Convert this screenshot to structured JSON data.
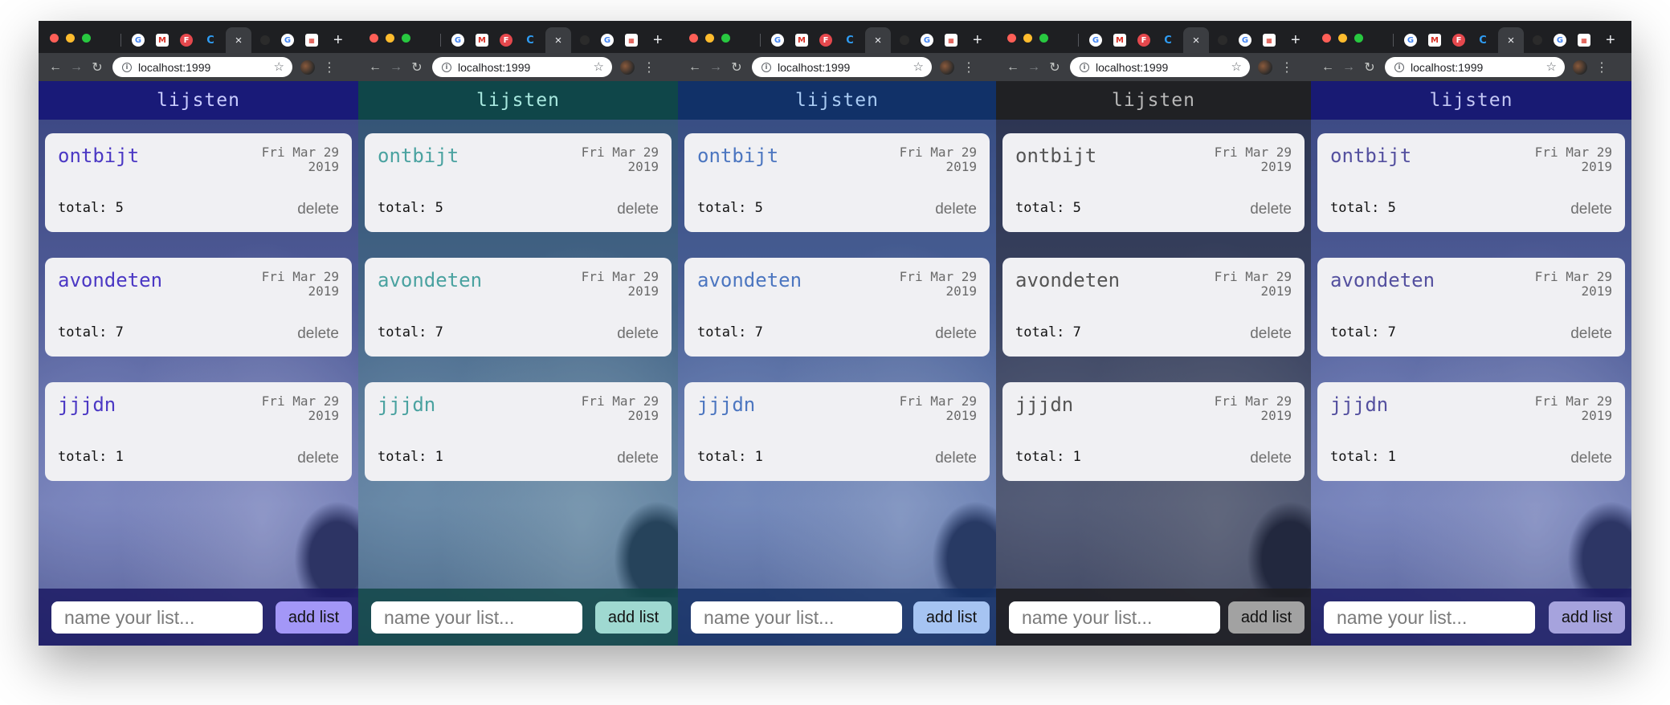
{
  "browser": {
    "url": "localhost:1999",
    "tab_close_glyph": "×",
    "new_tab_glyph": "+"
  },
  "app": {
    "title": "lijsten",
    "lists": [
      {
        "name": "ontbijt",
        "date_line1": "Fri Mar 29",
        "date_line2": "2019",
        "total_label": "total: 5",
        "delete_label": "delete"
      },
      {
        "name": "avondeten",
        "date_line1": "Fri Mar 29",
        "date_line2": "2019",
        "total_label": "total: 7",
        "delete_label": "delete"
      },
      {
        "name": "jjjdn",
        "date_line1": "Fri Mar 29",
        "date_line2": "2019",
        "total_label": "total: 1",
        "delete_label": "delete"
      }
    ],
    "input_placeholder": "name your list...",
    "add_button_label": "add list"
  },
  "themes": [
    {
      "name": "purple",
      "accent": "#4b38c4",
      "header": "#191a78",
      "button": "#a397f7"
    },
    {
      "name": "teal",
      "accent": "#4aa2a0",
      "header": "#0f4649",
      "button": "#9fd9d1"
    },
    {
      "name": "blue",
      "accent": "#4c76c0",
      "header": "#113168",
      "button": "#a6c4f2"
    },
    {
      "name": "grey",
      "accent": "#555555",
      "header": "#202124",
      "button": "#a2a2a2"
    },
    {
      "name": "lavender",
      "accent": "#54509f",
      "header": "#181a73",
      "button": "#a6a3dd"
    }
  ],
  "icons": {
    "tab_favicons": [
      "google-icon",
      "gmail-icon",
      "figma-icon",
      "c-icon",
      "github-icon",
      "google-icon",
      "calendar-icon"
    ],
    "nav": [
      "back-arrow-icon",
      "forward-arrow-icon",
      "reload-icon",
      "info-icon",
      "star-icon",
      "extension-icon",
      "menu-dots-icon"
    ]
  }
}
